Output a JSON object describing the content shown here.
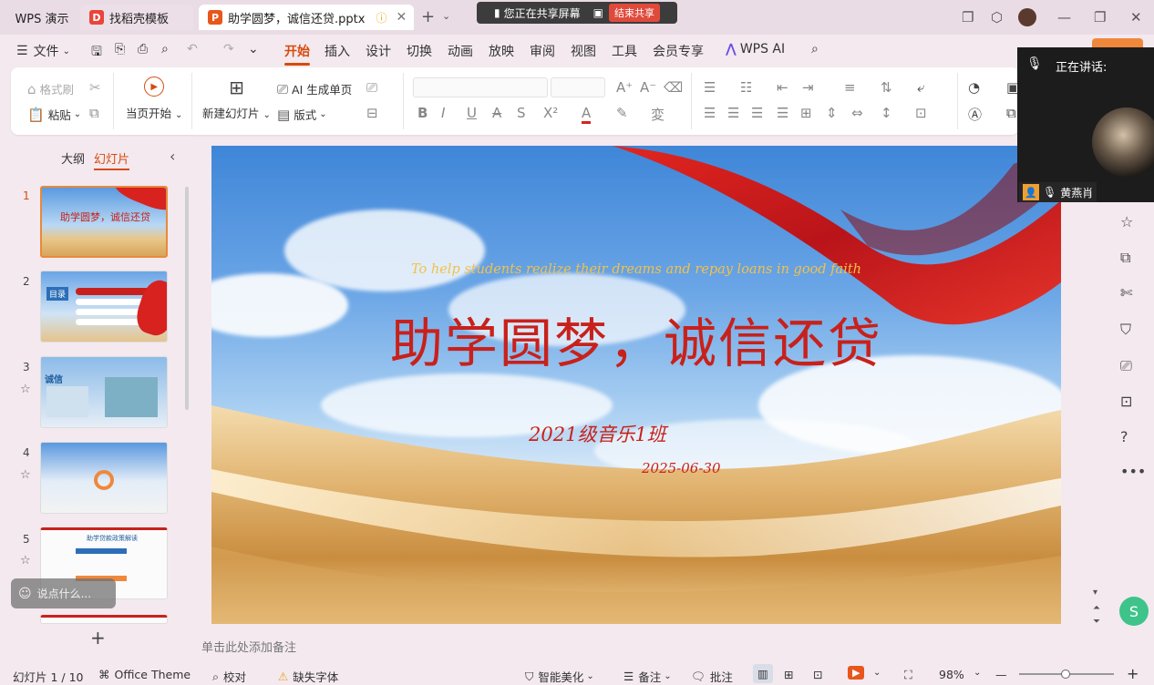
{
  "tabs": [
    {
      "label": "WPS 演示"
    },
    {
      "label": "找稻壳模板"
    },
    {
      "label": "助学圆梦，诚信还贷.pptx"
    }
  ],
  "share_bar": {
    "status": "您正在共享屏幕",
    "end_label": "结束共享"
  },
  "menu": {
    "file": "文件",
    "items": [
      "开始",
      "插入",
      "设计",
      "切换",
      "动画",
      "放映",
      "审阅",
      "视图",
      "工具",
      "会员专享"
    ],
    "wps_ai": "WPS AI"
  },
  "ribbon": {
    "format_painter": "格式刷",
    "paste": "粘贴",
    "play_from_current": "当页开始",
    "new_slide": "新建幻灯片",
    "ai_generate": "AI 生成单页",
    "layout": "版式"
  },
  "left_panel": {
    "outline_tab": "大纲",
    "slides_tab": "幻灯片",
    "add_slide": "+"
  },
  "thumbnails": [
    {
      "num": "1",
      "title": "助学圆梦，诚信还贷"
    },
    {
      "num": "2",
      "title": "目录"
    },
    {
      "num": "3",
      "title": "诚信"
    },
    {
      "num": "4",
      "title": ""
    },
    {
      "num": "5",
      "title": "助学贷款政策解读"
    }
  ],
  "comment_placeholder": "说点什么...",
  "slide": {
    "subtitle_en": "To help students realize their dreams and repay loans in good faith",
    "title": "助学圆梦，诚信还贷",
    "class_name": "2021级音乐1班",
    "date": "2025-06-30"
  },
  "notes_placeholder": "单击此处添加备注",
  "speaker_panel": {
    "label": "正在讲话:",
    "name": "黄燕肖"
  },
  "status_bar": {
    "slide_counter": "幻灯片 1 / 10",
    "theme": "Office Theme",
    "proofread": "校对",
    "missing_font": "缺失字体",
    "beautify": "智能美化",
    "notes": "备注",
    "comments": "批注",
    "zoom": "98%"
  },
  "colors": {
    "accent": "#d74b0d",
    "title_red": "#c8211b",
    "ribbon_red": "#d8221f"
  }
}
